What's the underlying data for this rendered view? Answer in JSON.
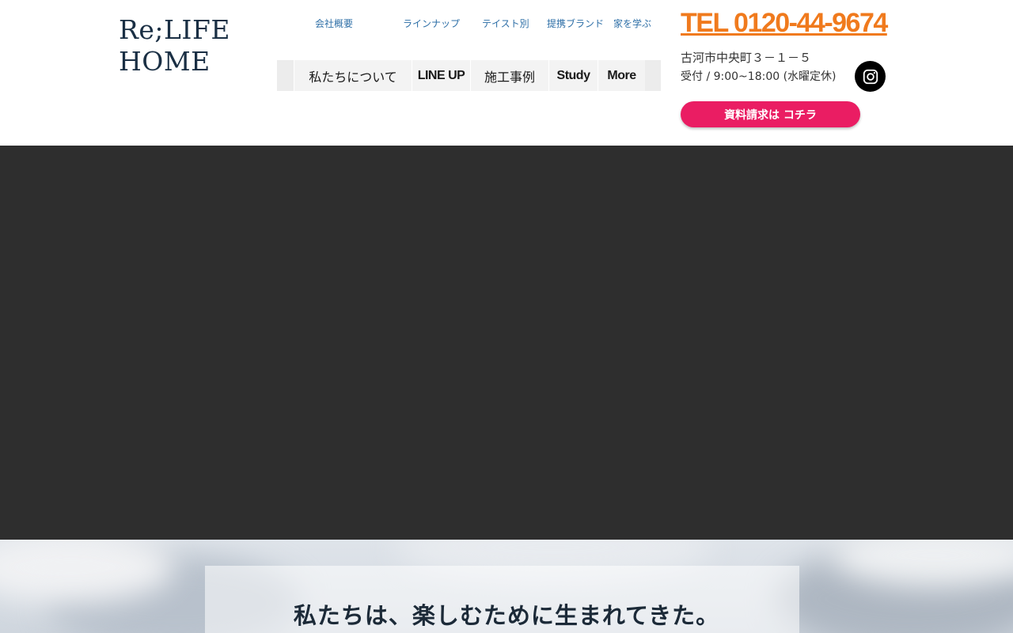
{
  "logo": {
    "line1": "Re;LIFE",
    "line2": "HOME"
  },
  "top_links": [
    {
      "label": "会社概要"
    },
    {
      "label": "ラインナップ"
    },
    {
      "label": "テイスト別"
    },
    {
      "label": "提携ブランド"
    },
    {
      "label": "家を学ぶ"
    }
  ],
  "main_nav": [
    {
      "label": "私たちについて"
    },
    {
      "label": "LINE UP"
    },
    {
      "label": "施工事例"
    },
    {
      "label": "Study"
    },
    {
      "label": "More"
    }
  ],
  "contact": {
    "tel": "TEL 0120-44-9674",
    "address": "古河市中央町３－１－５",
    "hours": "受付 / 9:00~18:00 (水曜定休)"
  },
  "social": {
    "icon": "instagram-icon"
  },
  "cta": {
    "label": "資料請求は コチラ"
  },
  "tagline": "私たちは、楽しむために生まれてきた。",
  "colors": {
    "logo": "#1a2f44",
    "link": "#2e6fa7",
    "tel": "#f07a1d",
    "cta": "#ea1d63",
    "hero": "#2e2e2e"
  }
}
